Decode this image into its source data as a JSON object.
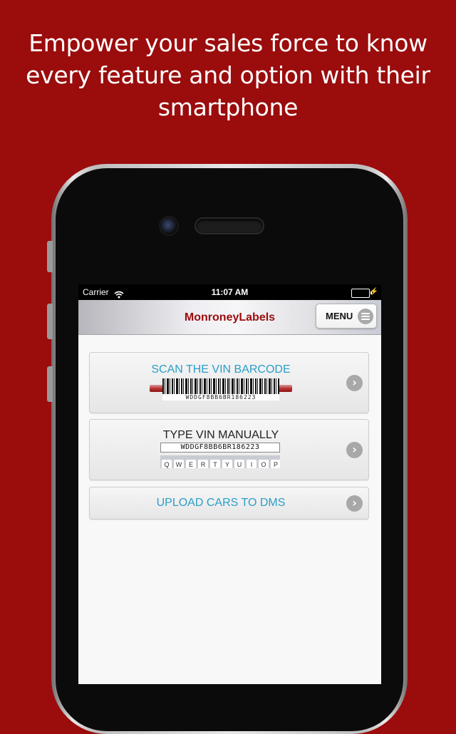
{
  "headline": "Empower your sales force to know every feature and option with their smartphone",
  "status_bar": {
    "carrier": "Carrier",
    "time": "11:07 AM"
  },
  "navbar": {
    "brand": "MonroneyLabels",
    "menu_label": "MENU"
  },
  "rows": [
    {
      "label": "SCAN THE VIN BARCODE",
      "color": "#2a9fc7",
      "vin": "WDDGF8BB6BR186223"
    },
    {
      "label": "TYPE VIN MANUALLY",
      "color": "#222222",
      "vin": "WDDGF8BB6BR186223",
      "keys": [
        "Q",
        "W",
        "E",
        "R",
        "T",
        "Y",
        "U",
        "I",
        "O",
        "P"
      ]
    },
    {
      "label": "UPLOAD CARS TO DMS",
      "color": "#2a9fc7"
    }
  ],
  "colors": {
    "background": "#9b0c0d",
    "brand": "#9b0c0d",
    "accent": "#2a9fc7"
  }
}
